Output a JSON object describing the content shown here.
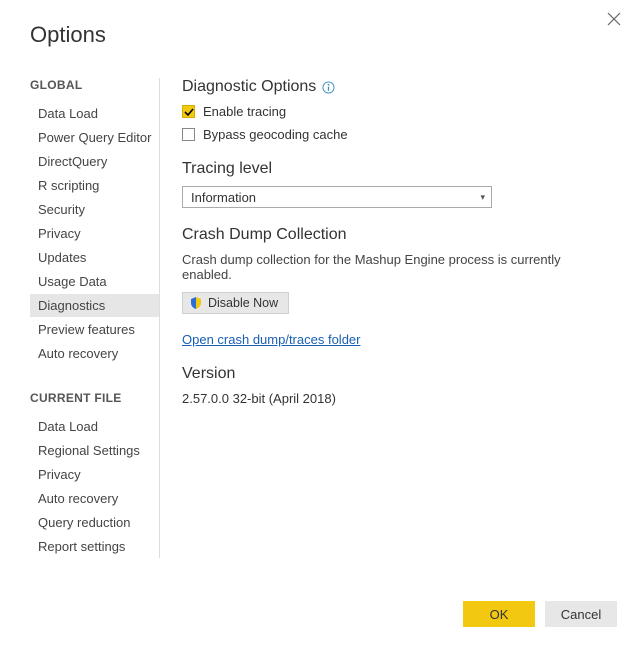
{
  "title": "Options",
  "sidebar": {
    "section1_label": "GLOBAL",
    "section1_items": [
      "Data Load",
      "Power Query Editor",
      "DirectQuery",
      "R scripting",
      "Security",
      "Privacy",
      "Updates",
      "Usage Data",
      "Diagnostics",
      "Preview features",
      "Auto recovery"
    ],
    "section1_selected_index": 8,
    "section2_label": "CURRENT FILE",
    "section2_items": [
      "Data Load",
      "Regional Settings",
      "Privacy",
      "Auto recovery",
      "Query reduction",
      "Report settings"
    ]
  },
  "main": {
    "diagnostic_options": {
      "heading": "Diagnostic Options",
      "enable_tracing_label": "Enable tracing",
      "enable_tracing_checked": true,
      "bypass_geocoding_label": "Bypass geocoding cache",
      "bypass_geocoding_checked": false
    },
    "tracing_level": {
      "heading": "Tracing level",
      "selected": "Information"
    },
    "crash_dump": {
      "heading": "Crash Dump Collection",
      "description": "Crash dump collection for the Mashup Engine process is currently enabled.",
      "disable_button_label": "Disable Now",
      "link_label": "Open crash dump/traces folder"
    },
    "version": {
      "heading": "Version",
      "value": "2.57.0.0 32-bit (April 2018)"
    }
  },
  "footer": {
    "ok_label": "OK",
    "cancel_label": "Cancel"
  }
}
